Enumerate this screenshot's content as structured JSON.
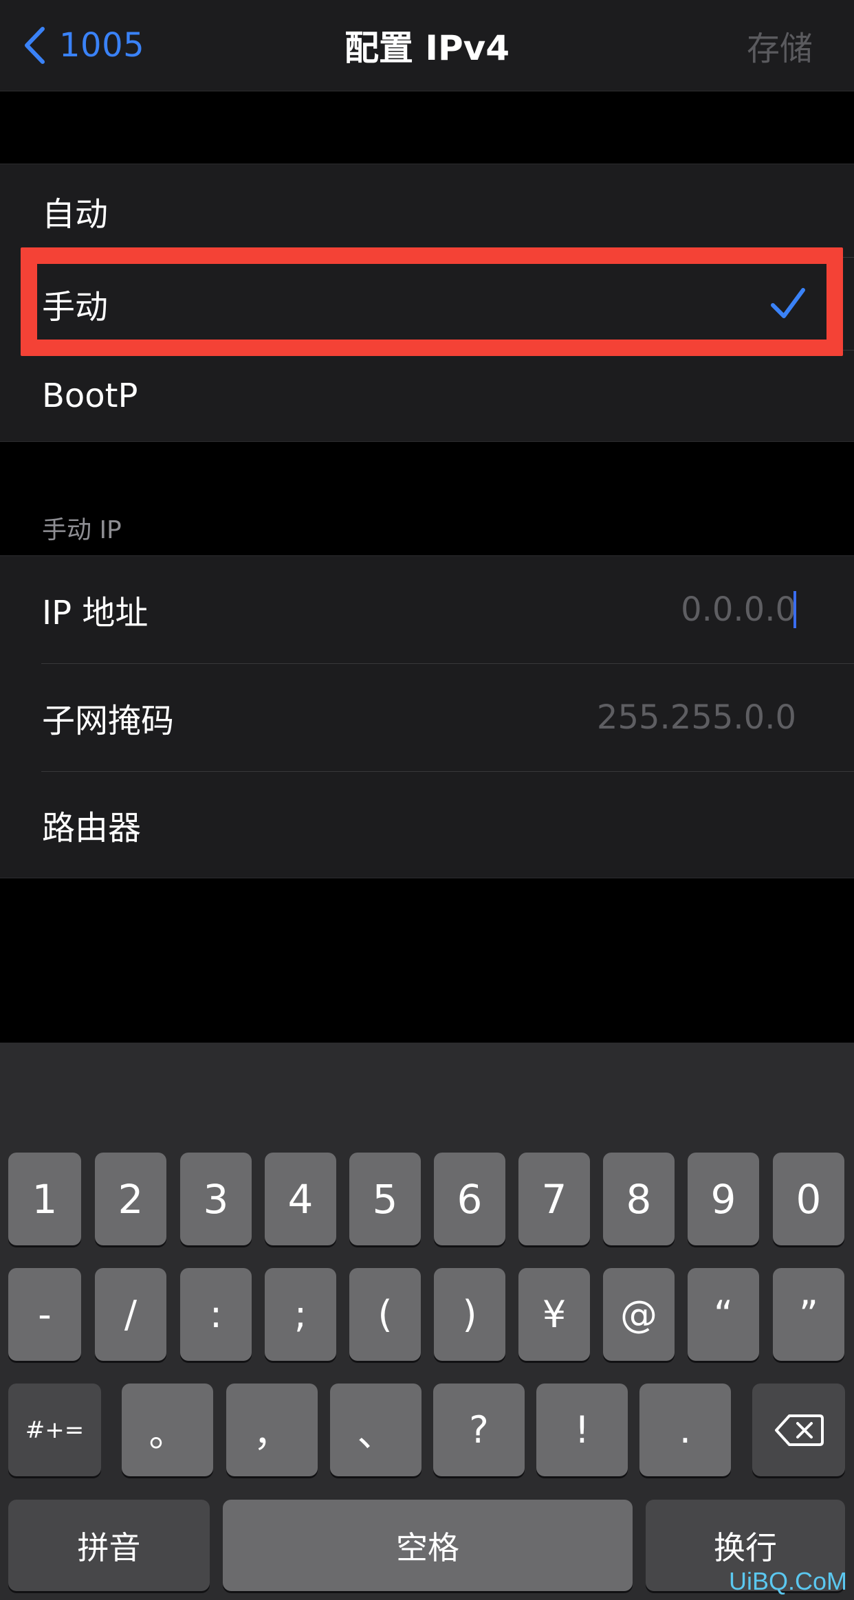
{
  "navbar": {
    "back_label": "1005",
    "title": "配置 IPv4",
    "save_label": "存储"
  },
  "configure": {
    "options": [
      {
        "label": "自动",
        "selected": false
      },
      {
        "label": "手动",
        "selected": true
      },
      {
        "label": "BootP",
        "selected": false
      }
    ]
  },
  "manual": {
    "header": "手动 IP",
    "fields": [
      {
        "label": "IP 地址",
        "value": "0.0.0.0"
      },
      {
        "label": "子网掩码",
        "value": "255.255.0.0"
      },
      {
        "label": "路由器",
        "value": ""
      }
    ]
  },
  "keyboard": {
    "row1": [
      "1",
      "2",
      "3",
      "4",
      "5",
      "6",
      "7",
      "8",
      "9",
      "0"
    ],
    "row2": [
      "-",
      "/",
      ":",
      ";",
      "(",
      ")",
      "¥",
      "@",
      "“",
      "”"
    ],
    "row3": [
      "#+=",
      "。",
      "，",
      "、",
      "?",
      "!",
      "."
    ],
    "bottom": {
      "pinyin": "拼音",
      "space": "空格",
      "return": "换行"
    }
  },
  "watermark": "UiBQ.CoM",
  "colors": {
    "accent": "#3a82f7",
    "highlight": "#f44236",
    "group_bg": "#1c1c1e",
    "keyboard_bg": "#2c2c2e"
  }
}
